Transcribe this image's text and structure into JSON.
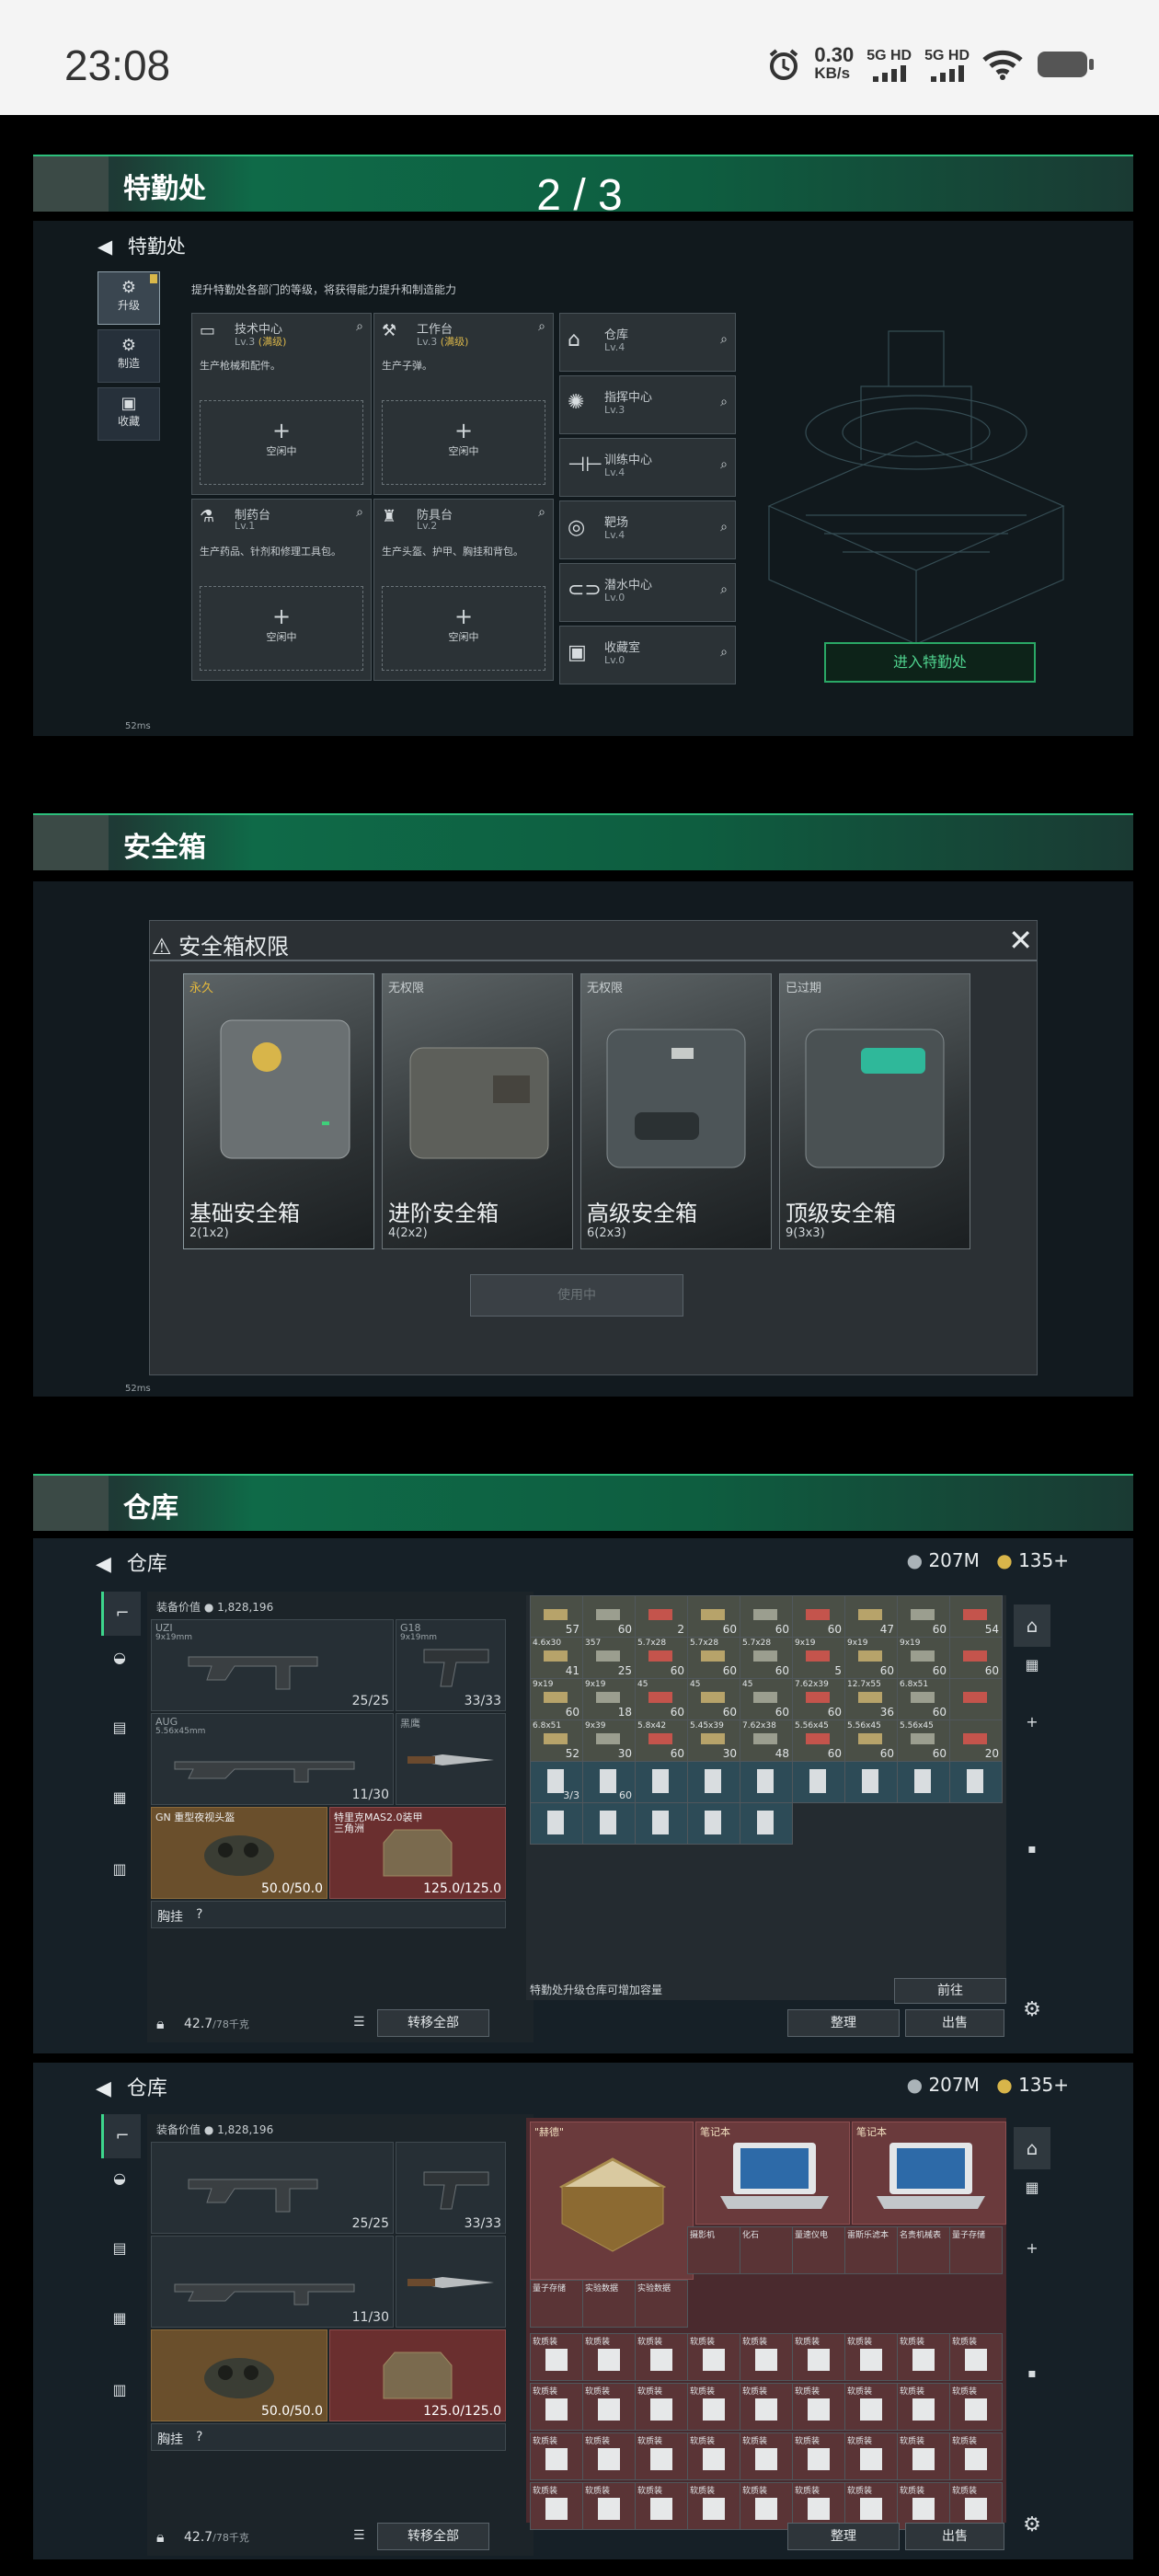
{
  "status_bar": {
    "time": "23:08",
    "net_speed": "0.30",
    "net_unit": "KB/s",
    "sig1": "5G HD",
    "sig2": "5G HD"
  },
  "viewer": {
    "page_indicator": "2 / 3"
  },
  "section1": {
    "header": "特勤处",
    "back_title": "特勤处",
    "desc": "提升特勤处各部门的等级，将获得能力提升和制造能力",
    "side_tabs": [
      {
        "label": "升级"
      },
      {
        "label": "制造"
      },
      {
        "label": "收藏"
      }
    ],
    "stations": [
      {
        "name": "技术中心",
        "level": "Lv.3",
        "tag": "(满级)",
        "desc": "生产枪械和配件。",
        "slot": "空闲中"
      },
      {
        "name": "工作台",
        "level": "Lv.3",
        "tag": "(满级)",
        "desc": "生产子弹。",
        "slot": "空闲中"
      },
      {
        "name": "制药台",
        "level": "Lv.1",
        "tag": "",
        "desc": "生产药品、针剂和修理工具包。",
        "slot": "空闲中"
      },
      {
        "name": "防具台",
        "level": "Lv.2",
        "tag": "",
        "desc": "生产头盔、护甲、胸挂和背包。",
        "slot": "空闲中"
      }
    ],
    "facilities": [
      {
        "name": "仓库",
        "level": "Lv.4"
      },
      {
        "name": "指挥中心",
        "level": "Lv.3"
      },
      {
        "name": "训练中心",
        "level": "Lv.4"
      },
      {
        "name": "靶场",
        "level": "Lv.4"
      },
      {
        "name": "潜水中心",
        "level": "Lv.0"
      },
      {
        "name": "收藏室",
        "level": "Lv.0"
      }
    ],
    "enter_button": "进入特勤处",
    "ping": "52ms"
  },
  "section2": {
    "header": "安全箱",
    "dialog_title": "安全箱权限",
    "boxes": [
      {
        "status": "永久",
        "name": "基础安全箱",
        "size": "2(1x2)"
      },
      {
        "status": "无权限",
        "name": "进阶安全箱",
        "size": "4(2x2)"
      },
      {
        "status": "无权限",
        "name": "高级安全箱",
        "size": "6(2x3)"
      },
      {
        "status": "已过期",
        "name": "顶级安全箱",
        "size": "9(3x3)"
      }
    ],
    "use_button": "使用中",
    "ping": "52ms"
  },
  "section3": {
    "header": "仓库",
    "title": "仓库",
    "currency1": "207M",
    "currency2": "135+",
    "equip_value_label": "装备价值",
    "equip_value": "1,828,196",
    "weapons": [
      {
        "name": "UZI",
        "sub": "9x19mm",
        "ammo": "25/25"
      },
      {
        "name": "G18",
        "sub": "9x19mm",
        "ammo": "33/33"
      },
      {
        "name": "AUG",
        "sub": "5.56x45mm",
        "ammo": "11/30"
      },
      {
        "name": "黑鹰",
        "sub": "",
        "ammo": ""
      }
    ],
    "helmet": {
      "name": "GN 重型夜视头盔",
      "dur": "50.0/50.0"
    },
    "armor": {
      "name": "特里克MAS2.0装甲",
      "sub": "三角洲",
      "dur": "125.0/125.0"
    },
    "chest_label": "胸挂",
    "chest_hint": "?",
    "weight": "42.7",
    "weight_max": "/78千克",
    "transfer_button": "转移全部",
    "ammo_counts": [
      [
        "57",
        "60",
        "2",
        "60",
        "60",
        "60",
        "47",
        "60",
        "54"
      ],
      [
        "41",
        "25",
        "60",
        "60",
        "60",
        "5",
        "60",
        "60",
        "60"
      ],
      [
        "60",
        "18",
        "60",
        "60",
        "60",
        "60",
        "36",
        "60",
        ""
      ],
      [
        "52",
        "30",
        "60",
        "30",
        "48",
        "60",
        "60",
        "60",
        "20"
      ]
    ],
    "ammo_labels": [
      [
        "",
        "",
        "",
        "",
        "",
        "",
        "",
        "",
        ""
      ],
      [
        "4.6x30",
        "357",
        "5.7x28",
        "5.7x28",
        "5.7x28",
        "9x19",
        "9x19",
        "9x19",
        ""
      ],
      [
        "9x19",
        "9x19",
        "45",
        "45",
        "45",
        "7.62x39",
        "12.7x55",
        "6.8x51",
        ""
      ],
      [
        "6.8x51",
        "9x39",
        "5.8x42",
        "5.45x39",
        "7.62x38",
        "5.56x45",
        "5.56x45",
        "5.56x45",
        ""
      ]
    ],
    "stack_label": "3/3",
    "plus_label": "60",
    "upgrade_hint": "特勤处升级仓库可增加容量",
    "goto_button": "前往",
    "sort_button": "整理",
    "sell_button": "出售"
  },
  "section4": {
    "title": "仓库",
    "currency1": "207M",
    "currency2": "135+",
    "equip_value_label": "装备价值",
    "equip_value": "1,828,196",
    "weapon_ammo": [
      "25/25",
      "33/33",
      "11/30"
    ],
    "helmet_dur": "50.0/50.0",
    "armor_dur": "125.0/125.0",
    "chest_label": "胸挂",
    "chest_hint": "?",
    "weight": "42.7",
    "weight_max": "/78千克",
    "transfer_button": "转移全部",
    "big_items": [
      {
        "label": "\"赫德\""
      },
      {
        "label": "笔记本"
      },
      {
        "label": "笔记本"
      }
    ],
    "small_items": [
      "摄影机",
      "化石",
      "量速仪电",
      "雷斯乐滤本",
      "名贵机械表",
      "量子存储",
      "量子存储",
      "实验数据",
      "实验数据"
    ],
    "gear_label": "软质装",
    "sort_button": "整理",
    "sell_button": "出售"
  }
}
